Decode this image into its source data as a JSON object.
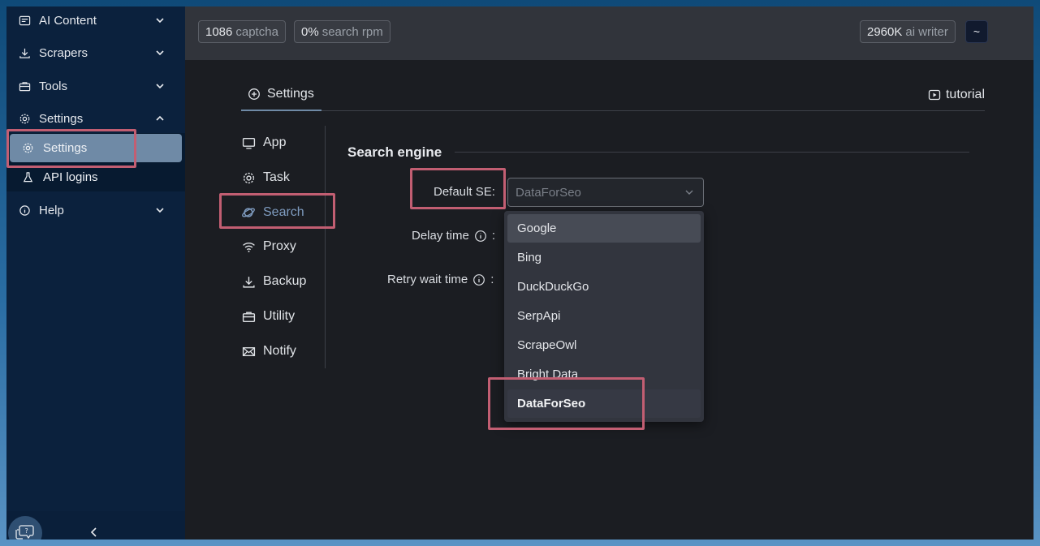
{
  "sidebar": {
    "items": [
      {
        "label": "AI Content",
        "icon": "ai-content-icon"
      },
      {
        "label": "Scrapers",
        "icon": "download-icon"
      },
      {
        "label": "Tools",
        "icon": "briefcase-icon"
      },
      {
        "label": "Settings",
        "icon": "gear-icon"
      },
      {
        "label": "Help",
        "icon": "info-icon"
      }
    ],
    "sub_items": [
      {
        "label": "Settings",
        "icon": "gear-icon",
        "active": true
      },
      {
        "label": "API logins",
        "icon": "flask-icon"
      }
    ]
  },
  "topbar": {
    "stats": [
      {
        "num": "1086",
        "label": "captcha"
      },
      {
        "num": "0%",
        "label": "search rpm"
      },
      {
        "num": "2960K",
        "label": "ai writer"
      }
    ],
    "tilde": "~"
  },
  "tabs": [
    {
      "label": "Settings",
      "icon": "plus-circle-icon"
    }
  ],
  "tutorial": {
    "label": "tutorial",
    "icon": "video-icon"
  },
  "subnav": [
    {
      "label": "App",
      "icon": "monitor-icon"
    },
    {
      "label": "Task",
      "icon": "gear-icon"
    },
    {
      "label": "Search",
      "icon": "planet-icon",
      "active": true
    },
    {
      "label": "Proxy",
      "icon": "wifi-icon"
    },
    {
      "label": "Backup",
      "icon": "download-icon"
    },
    {
      "label": "Utility",
      "icon": "briefcase-icon"
    },
    {
      "label": "Notify",
      "icon": "mail-icon"
    }
  ],
  "section": {
    "title": "Search engine"
  },
  "fields": {
    "default_se_label": "Default SE:",
    "delay_label": "Delay time",
    "retry_label": "Retry wait time",
    "colon": ":"
  },
  "select": {
    "value": "DataForSeo"
  },
  "dropdown": {
    "options": [
      "Google",
      "Bing",
      "DuckDuckGo",
      "SerpApi",
      "ScrapeOwl",
      "Bright Data",
      "DataForSeo"
    ],
    "hovered": "Google",
    "selected": "DataForSeo"
  },
  "colors": {
    "accent": "#7f9cc0",
    "highlight": "#c25e72",
    "sidebar_bg": "#0b213d"
  }
}
